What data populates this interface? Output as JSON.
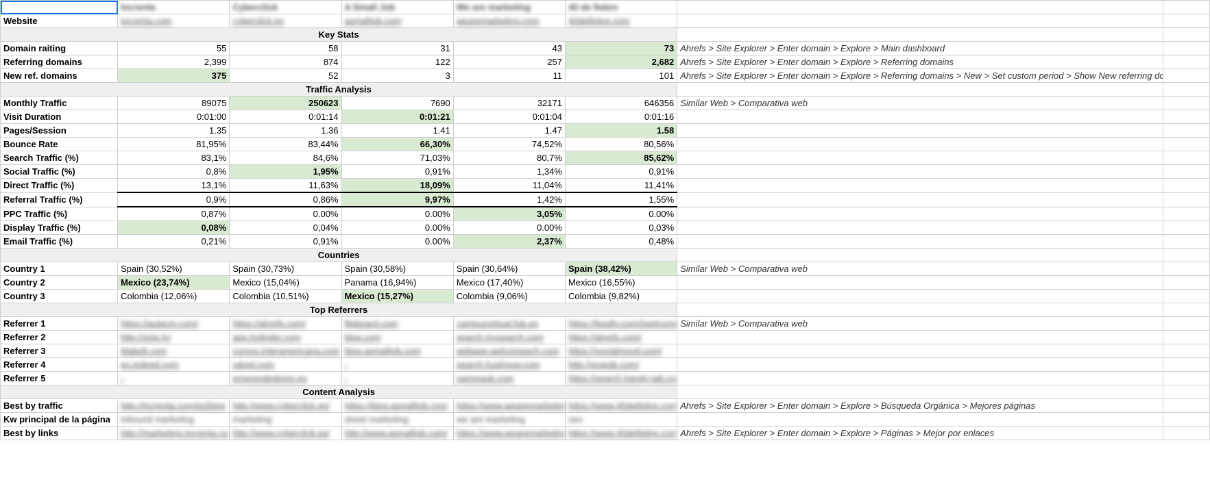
{
  "cols": [
    "c1",
    "c2",
    "c3",
    "c4",
    "c5"
  ],
  "headers": {
    "c1": "Increnta",
    "c2": "Cyberclick",
    "c3": "A Small Job",
    "c4": "We are marketing",
    "c5": "40 de fiebre"
  },
  "websiteLabel": "Website",
  "websites": {
    "c1": "increnta.com",
    "c2": "cyberclick.es",
    "c3": "asmalljob.com",
    "c4": "wearemarketing.com",
    "c5": "40defiebre.com"
  },
  "sections": {
    "keyStats": "Key Stats",
    "traffic": "Traffic Analysis",
    "countries": "Countries",
    "referrers": "Top Referrers",
    "content": "Content Analysis"
  },
  "rows": {
    "domainRaiting": {
      "label": "Domain raiting",
      "c1": "55",
      "c2": "58",
      "c3": "31",
      "c4": "43",
      "c5": "73",
      "note": "Ahrefs > Site Explorer > Enter domain > Explore > Main dashboard",
      "best": "c5"
    },
    "refDomains": {
      "label": "Referring domains",
      "c1": "2,399",
      "c2": "874",
      "c3": "122",
      "c4": "257",
      "c5": "2,682",
      "note": "Ahrefs > Site Explorer > Enter domain > Explore > Referring domains",
      "best": "c5"
    },
    "newRefDomains": {
      "label": "New ref. domains",
      "c1": "375",
      "c2": "52",
      "c3": "3",
      "c4": "11",
      "c5": "101",
      "note": "Ahrefs > Site Explorer > Enter domain > Explore > Referring domains > New > Set custom period > Show New referring domains",
      "best": "c1"
    },
    "monthlyTraffic": {
      "label": "Monthly Traffic",
      "c1": "89075",
      "c2": "250623",
      "c3": "7690",
      "c4": "32171",
      "c5": "646356",
      "note": "Similar Web > Comparativa web",
      "best": "c2"
    },
    "visitDuration": {
      "label": "Visit Duration",
      "c1": "0:01:00",
      "c2": "0:01:14",
      "c3": "0:01:21",
      "c4": "0:01:04",
      "c5": "0:01:16",
      "note": "",
      "best": "c3"
    },
    "pagesSession": {
      "label": "Pages/Session",
      "c1": "1.35",
      "c2": "1.36",
      "c3": "1.41",
      "c4": "1.47",
      "c5": "1.58",
      "note": "",
      "best": "c5"
    },
    "bounceRate": {
      "label": "Bounce Rate",
      "c1": "81,95%",
      "c2": "83,44%",
      "c3": "66,30%",
      "c4": "74,52%",
      "c5": "80,56%",
      "note": "",
      "best": "c3"
    },
    "searchTraffic": {
      "label": "Search Traffic (%)",
      "c1": "83,1%",
      "c2": "84,6%",
      "c3": "71,03%",
      "c4": "80,7%",
      "c5": "85,62%",
      "note": "",
      "best": "c5"
    },
    "socialTraffic": {
      "label": "Social Traffic (%)",
      "c1": "0,8%",
      "c2": "1,95%",
      "c3": "0,91%",
      "c4": "1,34%",
      "c5": "0,91%",
      "note": "",
      "best": "c2"
    },
    "directTraffic": {
      "label": "Direct Traffic (%)",
      "c1": "13,1%",
      "c2": "11,63%",
      "c3": "18,09%",
      "c4": "11,04%",
      "c5": "11,41%",
      "note": "",
      "best": "c3"
    },
    "referralTraffic": {
      "label": "Referral Traffic (%)",
      "c1": "0,9%",
      "c2": "0,86%",
      "c3": "9,97%",
      "c4": "1,42%",
      "c5": "1,55%",
      "note": "",
      "best": "c3"
    },
    "ppcTraffic": {
      "label": "PPC Traffic (%)",
      "c1": "0,87%",
      "c2": "0.00%",
      "c3": "0.00%",
      "c4": "3,05%",
      "c5": "0.00%",
      "note": "",
      "best": "c4"
    },
    "displayTraffic": {
      "label": "Display Traffic (%)",
      "c1": "0,08%",
      "c2": "0,04%",
      "c3": "0.00%",
      "c4": "0.00%",
      "c5": "0,03%",
      "note": "",
      "best": "c1"
    },
    "emailTraffic": {
      "label": "Email Traffic (%)",
      "c1": "0,21%",
      "c2": "0,91%",
      "c3": "0.00%",
      "c4": "2,37%",
      "c5": "0,48%",
      "note": "",
      "best": "c4"
    },
    "country1": {
      "label": "Country 1",
      "c1": "Spain (30,52%)",
      "c2": "Spain (30,73%)",
      "c3": "Spain (30,58%)",
      "c4": "Spain (30,64%)",
      "c5": "Spain (38,42%)",
      "note": "Similar Web > Comparativa web",
      "best": "c5"
    },
    "country2": {
      "label": "Country 2",
      "c1": "Mexico (23,74%)",
      "c2": "Mexico (15,04%)",
      "c3": "Panama (16,94%)",
      "c4": "Mexico (17,40%)",
      "c5": "Mexico (16,55%)",
      "note": "",
      "best": "c1"
    },
    "country3": {
      "label": "Country 3",
      "c1": "Colombia (12,06%)",
      "c2": "Colombia (10,51%)",
      "c3": "Mexico (15,27%)",
      "c4": "Colombia (9,06%)",
      "c5": "Colombia (9,82%)",
      "note": "",
      "best": "c3"
    },
    "ref1": {
      "label": "Referrer 1",
      "c1": "https://aulacm.com/",
      "c2": "https://ahrefs.com/",
      "c3": "flipboard.com",
      "c4": "campusvirtual.fub.es",
      "c5": "https://feedly.com/i/welcome",
      "note": "Similar Web > Comparativa web"
    },
    "ref2": {
      "label": "Referrer 2",
      "c1": "http://snip.ly/",
      "c2": "app.holinder.com",
      "c3": "blog.com",
      "c4": "search.mysearch.com",
      "c5": "https://ahrefs.com/"
    },
    "ref3": {
      "label": "Referrer 3",
      "c1": "Mabelt.com",
      "c2": "cursos.interamericana.com",
      "c3": "blog.asmalljob.com",
      "c4": "webapp.welcomeach.com",
      "c5": "https://socialmood.com/"
    },
    "ref4": {
      "label": "Referrer 4",
      "c1": "es.indeed.com",
      "c2": "ralopt.com",
      "c3": "-",
      "c4": "search.hushnow.com",
      "c5": "http://gogoib.com/"
    },
    "ref5": {
      "label": "Referrer 5",
      "c1": "-",
      "c2": "emprendedores.es",
      "c3": "-",
      "c4": "sammask.com",
      "c5": "https://search.handy-tab.com/#/"
    },
    "bestTraffic": {
      "label": "Best by traffic",
      "c1": "http://increnta.com/es/blog",
      "c2": "http://www.cyberclick.es/",
      "c3": "https://blog.asmalljob.com",
      "c4": "https://www.wearemarketing",
      "c5": "https://www.40defiebre.com",
      "note": "Ahrefs > Site Explorer > Enter domain > Explore > Búsqueda Orgánica > Mejores páginas"
    },
    "kwPrincipal": {
      "label": "Kw principal de la página",
      "c1": "inbound marketing",
      "c2": "marketing",
      "c3": "street marketing",
      "c4": "we are marketing",
      "c5": "seo"
    },
    "bestLinks": {
      "label": "Best by links",
      "c1": "http://marketing.increnta.co",
      "c2": "http://www.cyberclick.es/",
      "c3": "http://www.asmalljob.com/",
      "c4": "https://www.wearemarketing",
      "c5": "https://www.40defiebre.com",
      "note": "Ahrefs > Site Explorer > Enter domain > Explore > Páginas > Mejor por enlaces"
    }
  }
}
